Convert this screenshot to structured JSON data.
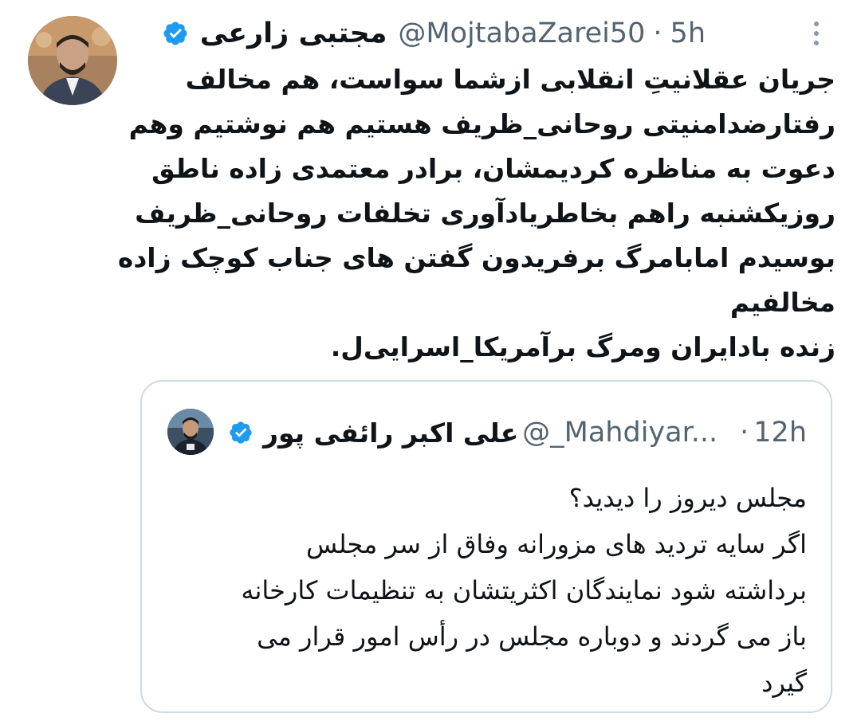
{
  "tweet": {
    "author_name": "مجتبی زارعی",
    "handle": "@MojtabaZarei50",
    "separator": "·",
    "time": "5h",
    "text_lines": [
      "جریان عقلانیتِ انقلابی ازشما سواست، هم مخالف",
      "رفتارضدامنیتی روحانی_ظریف هستیم هم نوشتیم وهم",
      "دعوت به مناظره کردیمشان، برادر معتمدی زاده ناطق",
      "روزیکشنبه راهم بخاطریادآوری تخلفات روحانی_ظریف",
      "بوسیدم امابامرگ برفریدون گفتن های جناب کوچک زاده",
      "مخالفیم",
      "زنده بادایران ومرگ برآمریکا_اسرایی‌ل."
    ]
  },
  "quote": {
    "author_name": "علی اکبر رائفی پور",
    "handle": "@_Mahdiyar...",
    "separator": "·",
    "time": "12h",
    "text_lines": [
      "مجلس دیروز را دیدید؟",
      "اگر سایه تردید های مزورانه وفاق از سر مجلس",
      "برداشته شود نمایندگان اکثریتشان به تنظیمات کارخانه",
      "باز می گردند و دوباره مجلس در رأس امور قرار می",
      "گیرد"
    ]
  },
  "colors": {
    "verified": "#1d9bf0",
    "muted": "#536471",
    "text": "#0f1419",
    "border": "#cfd9de"
  },
  "icons": {
    "verified": "verified-badge-icon",
    "more": "more-vertical-icon"
  }
}
